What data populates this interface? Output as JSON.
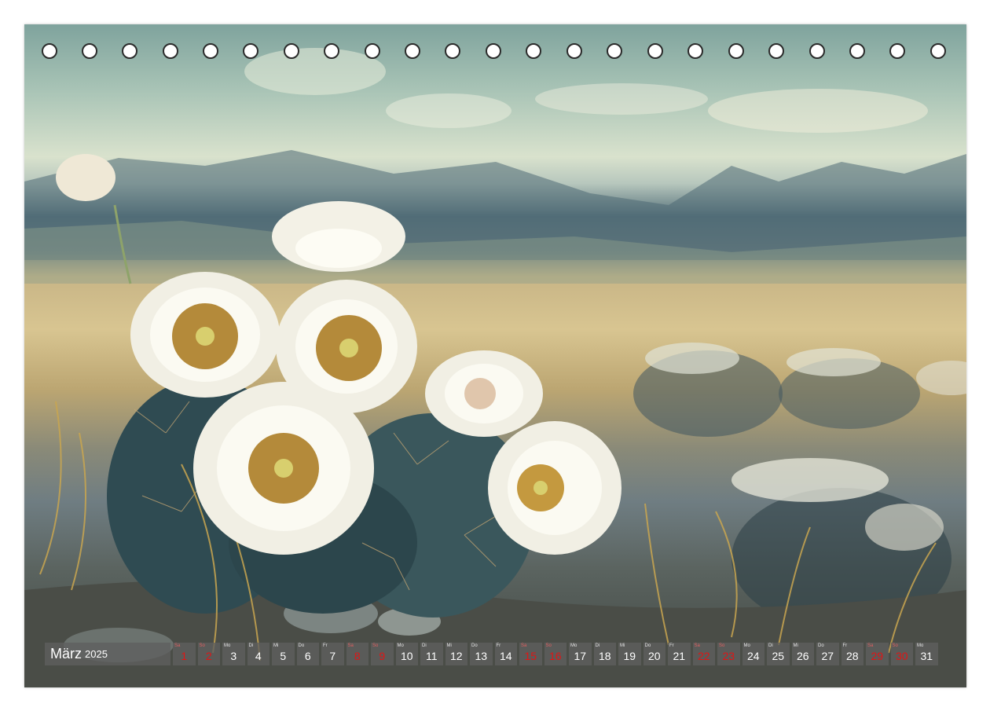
{
  "calendar": {
    "month": "März",
    "year": "2025",
    "days": [
      {
        "num": "1",
        "wd": "Sa",
        "red": true
      },
      {
        "num": "2",
        "wd": "So",
        "red": true
      },
      {
        "num": "3",
        "wd": "Mo",
        "red": false
      },
      {
        "num": "4",
        "wd": "Di",
        "red": false
      },
      {
        "num": "5",
        "wd": "Mi",
        "red": false
      },
      {
        "num": "6",
        "wd": "Do",
        "red": false
      },
      {
        "num": "7",
        "wd": "Fr",
        "red": false
      },
      {
        "num": "8",
        "wd": "Sa",
        "red": true
      },
      {
        "num": "9",
        "wd": "So",
        "red": true
      },
      {
        "num": "10",
        "wd": "Mo",
        "red": false
      },
      {
        "num": "11",
        "wd": "Di",
        "red": false
      },
      {
        "num": "12",
        "wd": "Mi",
        "red": false
      },
      {
        "num": "13",
        "wd": "Do",
        "red": false
      },
      {
        "num": "14",
        "wd": "Fr",
        "red": false
      },
      {
        "num": "15",
        "wd": "Sa",
        "red": true
      },
      {
        "num": "16",
        "wd": "So",
        "red": true
      },
      {
        "num": "17",
        "wd": "Mo",
        "red": false
      },
      {
        "num": "18",
        "wd": "Di",
        "red": false
      },
      {
        "num": "19",
        "wd": "Mi",
        "red": false
      },
      {
        "num": "20",
        "wd": "Do",
        "red": false
      },
      {
        "num": "21",
        "wd": "Fr",
        "red": false
      },
      {
        "num": "22",
        "wd": "Sa",
        "red": true
      },
      {
        "num": "23",
        "wd": "So",
        "red": true
      },
      {
        "num": "24",
        "wd": "Mo",
        "red": false
      },
      {
        "num": "25",
        "wd": "Di",
        "red": false
      },
      {
        "num": "26",
        "wd": "Mi",
        "red": false
      },
      {
        "num": "27",
        "wd": "Do",
        "red": false
      },
      {
        "num": "28",
        "wd": "Fr",
        "red": false
      },
      {
        "num": "29",
        "wd": "Sa",
        "red": true
      },
      {
        "num": "30",
        "wd": "So",
        "red": true
      },
      {
        "num": "31",
        "wd": "Mo",
        "red": false
      }
    ]
  },
  "colors": {
    "weekend_red": "#e01515",
    "cell_bg": "#5f5f5f"
  }
}
